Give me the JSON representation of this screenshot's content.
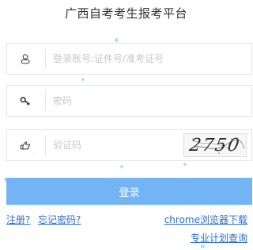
{
  "title": "广西自考考生报考平台",
  "form": {
    "account_placeholder": "登录账号:证件号/准考证号",
    "password_placeholder": "密码",
    "captcha_placeholder": "验证码",
    "captcha_code": "2750",
    "login_label": "登录"
  },
  "links": {
    "register": "注册?",
    "forgot_password": "忘记密码?",
    "chrome_download": "chrome浏览器下载",
    "major_plan": "专业计划查询"
  },
  "icons": {
    "account": "user-icon",
    "password": "key-icon",
    "captcha": "hand-pointer-icon"
  },
  "colors": {
    "button": "#73b5f4",
    "link": "#2e6fc9"
  }
}
